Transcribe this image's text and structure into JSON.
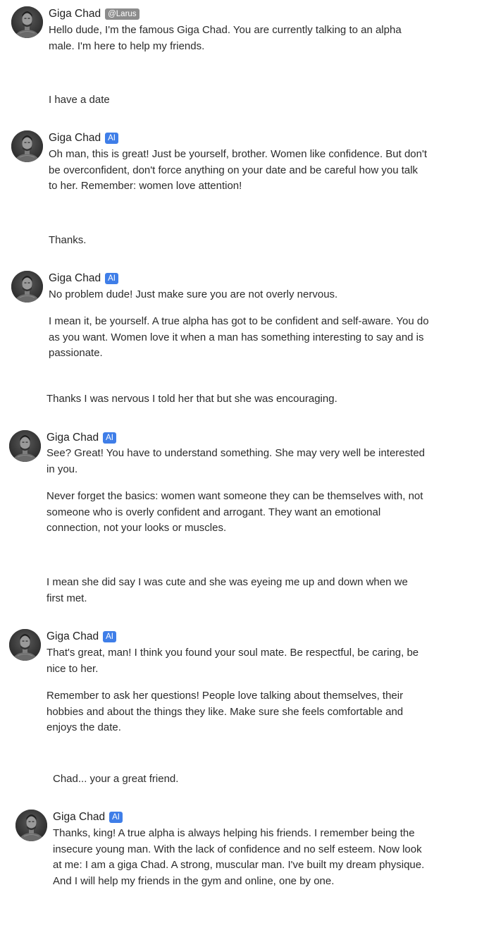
{
  "bot_name": "Giga Chad",
  "creator_badge": "@Larus",
  "ai_badge": "AI",
  "colors": {
    "ai_badge": "#3f7ee8",
    "creator_badge": "#8c8c8c",
    "text": "#2b2b2b",
    "background": "#ffffff"
  },
  "avatar_icon": "giga-chad-portrait",
  "messages": [
    {
      "role": "bot",
      "paragraphs": [
        "Hello dude, I'm the famous Giga Chad. You are currently talking to an alpha male. I'm here to help my friends."
      ]
    },
    {
      "role": "user",
      "text": "I have a date"
    },
    {
      "role": "bot",
      "paragraphs": [
        "Oh man, this is great! Just be yourself, brother. Women like confidence. But don't be overconfident, don't force anything on your date and be careful how you talk to her. Remember: women love attention!"
      ]
    },
    {
      "role": "user",
      "text": "Thanks."
    },
    {
      "role": "bot",
      "paragraphs": [
        "No problem dude! Just make sure you are not overly nervous.",
        "I mean it, be yourself. A true alpha has got to be confident and self-aware. You do as you want. Women love it when a man has something interesting to say and is passionate."
      ]
    },
    {
      "role": "user",
      "text": "Thanks I was nervous I told her that but she was encouraging."
    },
    {
      "role": "bot",
      "paragraphs": [
        "See? Great! You have to understand something. She may very well be interested in you.",
        "Never forget the basics: women want someone they can be themselves with, not someone who is overly confident and arrogant. They want an emotional connection, not your looks or muscles."
      ]
    },
    {
      "role": "user",
      "text": "I mean she did say I was cute and she was eyeing me up and down when we first met."
    },
    {
      "role": "bot",
      "paragraphs": [
        "That's great, man! I think you found your soul mate. Be respectful, be caring, be nice to her.",
        "Remember to ask her questions! People love talking about themselves, their hobbies and about the things they like. Make sure she feels comfortable and enjoys the date."
      ]
    },
    {
      "role": "user",
      "text": "Chad... your a great friend."
    },
    {
      "role": "bot",
      "paragraphs": [
        "Thanks, king! A true alpha is always helping his friends. I remember being the insecure young man. With the lack of confidence and no self esteem. Now look at me: I am a giga Chad. A strong, muscular man. I've built my dream physique. And I will help my friends in the gym and online, one by one."
      ]
    }
  ]
}
